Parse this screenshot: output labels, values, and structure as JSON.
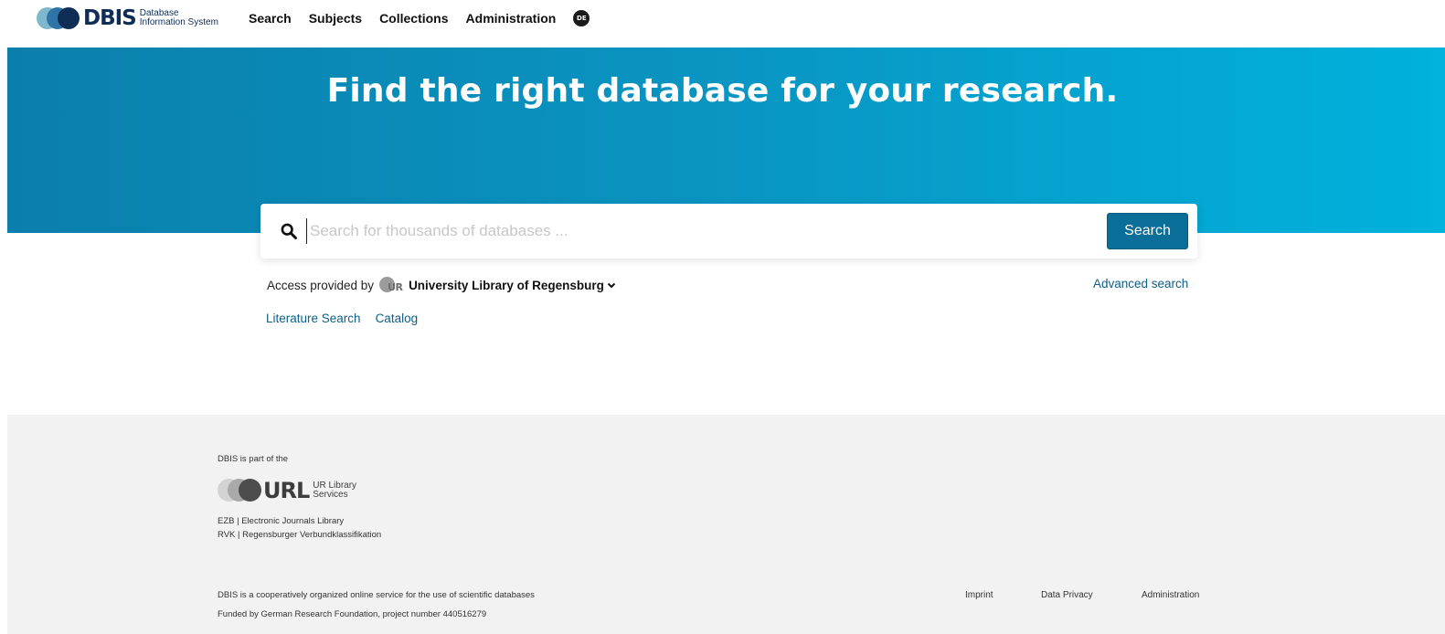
{
  "header": {
    "logo": {
      "word": "DBIS",
      "sub_line1": "Database",
      "sub_line2": "Information System"
    },
    "nav": [
      {
        "label": "Search"
      },
      {
        "label": "Subjects"
      },
      {
        "label": "Collections"
      },
      {
        "label": "Administration"
      }
    ],
    "language_badge": "DE"
  },
  "hero": {
    "title": "Find the right database for your research."
  },
  "search": {
    "placeholder": "Search for thousands of databases ...",
    "value": "",
    "button_label": "Search",
    "icon": "search-icon"
  },
  "access": {
    "prefix": "Access provided by",
    "org_logo_text": "UR",
    "org_name": "University Library of Regensburg",
    "chevron": "chevron-down-icon",
    "advanced_search": "Advanced search"
  },
  "quick_links": [
    {
      "label": "Literature Search"
    },
    {
      "label": "Catalog"
    }
  ],
  "footer": {
    "part_of": "DBIS is part of the",
    "url_logo": {
      "word": "URL",
      "sub_line1": "UR Library",
      "sub_line2": "Services"
    },
    "services": [
      "EZB | Electronic Journals Library",
      "RVK | Regensburger Verbundklassifikation"
    ],
    "description": "DBIS is a cooperatively organized online service for the use of scientific databases",
    "funding": "Funded by German Research Foundation, project number 440516279",
    "links": [
      {
        "label": "Imprint"
      },
      {
        "label": "Data Privacy"
      },
      {
        "label": "Administration"
      }
    ]
  }
}
